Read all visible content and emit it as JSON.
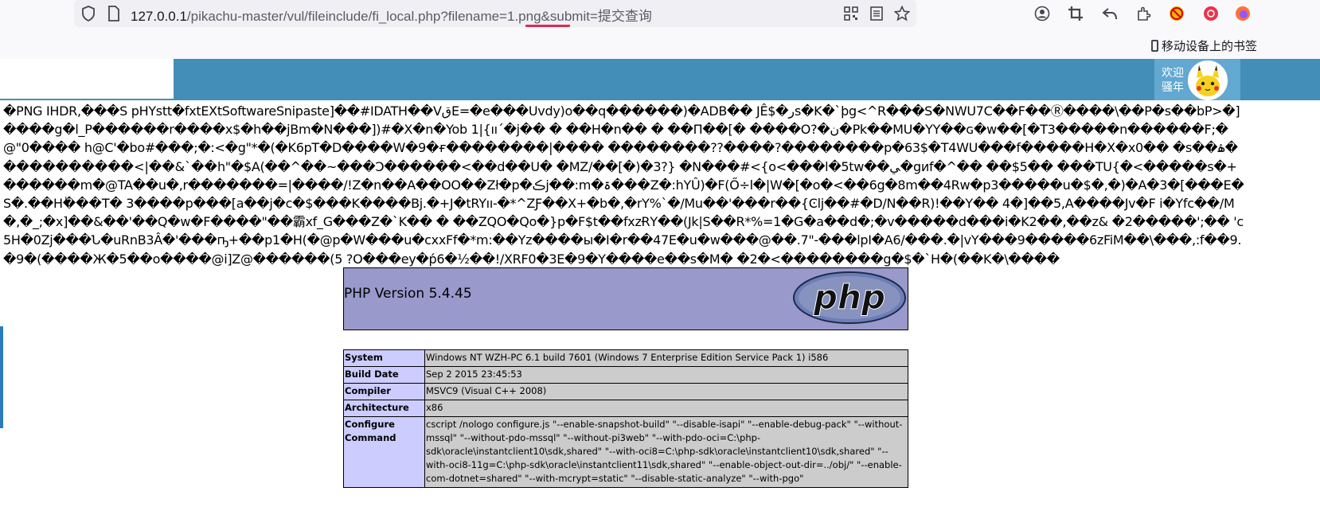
{
  "browser": {
    "url_host": "127.0.0.1",
    "url_path": "/pikachu-master/vul/fileinclude/fi_local.php?filename=1.png&submit=提交查询",
    "bookmark_mobile": "移动设备上的书签"
  },
  "header": {
    "welcome": "欢迎\n骚年"
  },
  "garbled_output": "�PNG  IHDR,���S pHYstt�fxtEXtSoftwareSnipaste]��#IDATH��VقE=�e���Uvdy)o��q������)�ADB�� JÊ$�رs�K�`þg<^R���S�NWU7C��F��Ⓡ����\\��P�s��bP>�]����g�l_P������r����x$�h��jBm�N���])#�X�n�Yob 1|{ııˊ�j�� � ��H�n�� � ��П��[� ����O?�ن�Pk��MU�YY��ɢ�w��[�T3�����n������F;�@\"0���� h@C'�bo#���;�:<�g\"*�(�K6pT�D����W�9�ғ��������|���� ��������??����?��������p�63$�T4WU���f�����H�X�x0�� �s��ۿ�����������<|��&`��h\"�$A(��^��~���Ͻ������<��d��U� �MZ/��[�)�3?} �N���#<{o<���l�5tw��ﻲ�gͷf�^�� ��$5�� ���TU{�<�����s�+������m�@TA��u�,r�������=|����/!Z�n��A��OO݇��Zł�p�ڪj��:m�ۃ���Z�:hYÛ)�F(Ő÷l�|W�[�o�<��6g�8m��4Rw�p3�����u�$�,�)�A�3�[���E�S�.��H�ٰ��T� 3����p���[a��j�c�$���K����Bj.�+J�tRYıı-�*^ZƑ��X+�b�,�rY%`�/Mu��'���r��{Ͼlj��#�D/N��R)!��Y�� 4�]��5,A����Jv�F i�Yfc��/M�,�_;�x]��&��'��Q�w�F����\"��霸xf_G���Z�`K�� � ��ZQO�Qo�}p�F$t��fxzɌY��(Jk|S��R*%=1�G�a��d�;�v�����d���i�K2��,��z& �2�����';�� 'c5H�0Zj���Ն�uRnB3Â�'���ҧ+��p1�H(�@p�W���u�cxxFf�*m:��Yz����ы�I�r��47E�u�w���@��.7\"-���lpI�A6/���.�|vY���9�����6zFiM��\\���,:f��9.�9�(����Ж�5��o����@i]Z@������(5 ?O���ey�ṕ6�½��!/XRF0�3E�9�Y����e��s�M� �2�<��������g�$�`H�(��K�\\����",
  "phpinfo": {
    "version": "PHP Version 5.4.45",
    "logo_text": "php",
    "rows": [
      {
        "key": "System",
        "value": "Windows NT WZH-PC 6.1 build 7601 (Windows 7 Enterprise Edition Service Pack 1) i586"
      },
      {
        "key": "Build Date",
        "value": "Sep 2 2015 23:45:53"
      },
      {
        "key": "Compiler",
        "value": "MSVC9 (Visual C++ 2008)"
      },
      {
        "key": "Architecture",
        "value": "x86"
      },
      {
        "key": "Configure Command",
        "value": "cscript /nologo configure.js \"--enable-snapshot-build\" \"--disable-isapi\" \"--enable-debug-pack\" \"--without-mssql\" \"--without-pdo-mssql\" \"--without-pi3web\" \"--with-pdo-oci=C:\\php-sdk\\oracle\\instantclient10\\sdk,shared\" \"--with-oci8=C:\\php-sdk\\oracle\\instantclient10\\sdk,shared\" \"--with-oci8-11g=C:\\php-sdk\\oracle\\instantclient11\\sdk,shared\" \"--enable-object-out-dir=../obj/\" \"--enable-com-dotnet=shared\" \"--with-mcrypt=static\" \"--disable-static-analyze\" \"--with-pgo\""
      }
    ]
  },
  "colors": {
    "header_blue": "#438eb9",
    "php_head": "#9999cc",
    "key_cell": "#ccccff",
    "value_cell": "#cccccc"
  }
}
